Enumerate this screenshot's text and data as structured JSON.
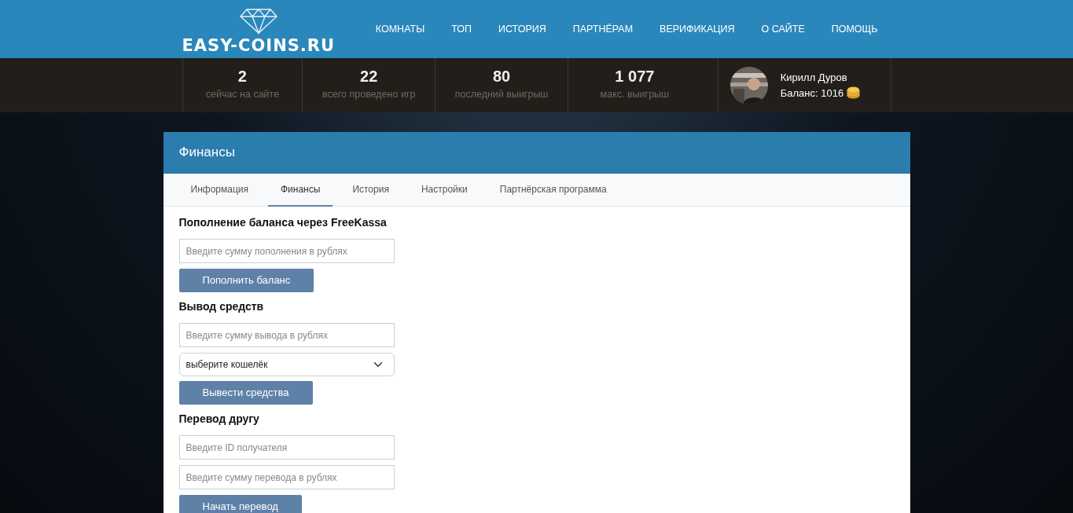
{
  "logo": {
    "text": "EASY-COINS.RU"
  },
  "nav": [
    {
      "label": "КОМНАТЫ"
    },
    {
      "label": "ТОП"
    },
    {
      "label": "ИСТОРИЯ"
    },
    {
      "label": "ПАРТНЁРАМ"
    },
    {
      "label": "ВЕРИФИКАЦИЯ"
    },
    {
      "label": "О САЙТЕ"
    },
    {
      "label": "ПОМОЩЬ"
    }
  ],
  "stats": [
    {
      "value": "2",
      "label": "сейчас на сайте"
    },
    {
      "value": "22",
      "label": "всего проведено игр"
    },
    {
      "value": "80",
      "label": "последний выигрыш"
    },
    {
      "value": "1 077",
      "label": "макс. выигрыш"
    }
  ],
  "user": {
    "name": "Кирилл Дуров",
    "balance": "Баланс: 1016"
  },
  "panel": {
    "title": "Финансы",
    "tabs": [
      {
        "label": "Информация",
        "selected": false
      },
      {
        "label": "Финансы",
        "selected": true
      },
      {
        "label": "История",
        "selected": false
      },
      {
        "label": "Настройки",
        "selected": false
      },
      {
        "label": "Партнёрская программа",
        "selected": false
      }
    ],
    "sections": [
      {
        "heading": "Пополнение баланса через FreeKassa",
        "fields": [
          {
            "kind": "input",
            "placeholder": "Введите сумму пополнения в рублях"
          }
        ],
        "button": "Пополнить баланс"
      },
      {
        "heading": "Вывод средств",
        "fields": [
          {
            "kind": "input",
            "placeholder": "Введите сумму вывода в рублях"
          },
          {
            "kind": "select",
            "value": "выберите кошелёк"
          }
        ],
        "button": "Вывести средства"
      },
      {
        "heading": "Перевод другу",
        "fields": [
          {
            "kind": "input",
            "placeholder": "Введите ID получателя"
          },
          {
            "kind": "input",
            "placeholder": "Введите сумму перевода в рублях"
          }
        ],
        "button": "Начать перевод"
      }
    ]
  }
}
